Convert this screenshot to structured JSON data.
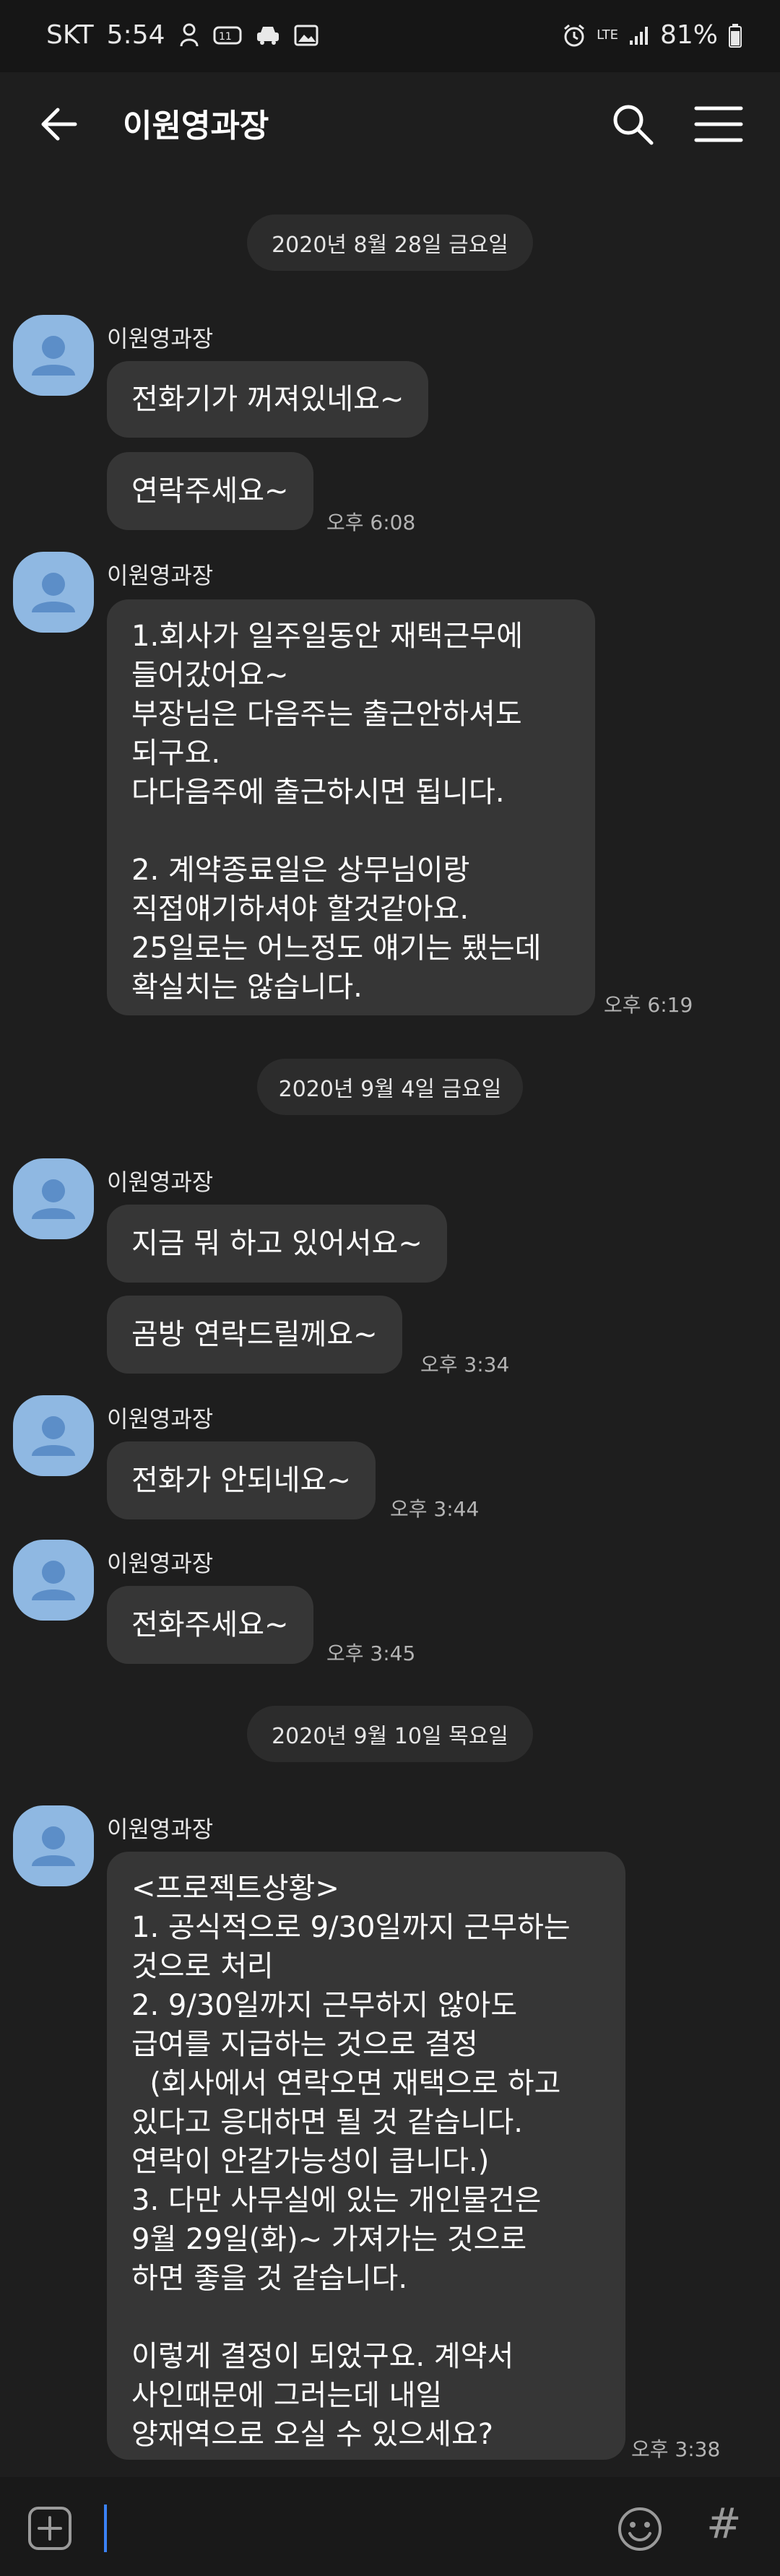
{
  "status_bar": {
    "carrier": "SKT",
    "time": "5:54",
    "signal_label": "LTE",
    "battery": "81%"
  },
  "header": {
    "title": "이원영과장"
  },
  "messages": {
    "date1": "2020년 8월 28일 금요일",
    "sender": "이원영과장",
    "m1": "전화기가 꺼져있네요~",
    "m2": "연락주세요~",
    "t2": "오후 6:08",
    "m3": [
      "1.회사가 일주일동안 재택근무에",
      "들어갔어요~",
      "부장님은 다음주는 출근안하셔도",
      "되구요.",
      "다다음주에 출근하시면 됩니다.",
      "",
      "2. 계약종료일은 상무님이랑",
      "직접얘기하셔야 할것같아요.",
      "25일로는 어느정도 얘기는 됐는데",
      "확실치는 않습니다."
    ],
    "t3": "오후 6:19",
    "date2": "2020년 9월 4일 금요일",
    "m4": "지금 뭐 하고 있어서요~",
    "m5": "곰방 연락드릴께요~",
    "t5": "오후 3:34",
    "m6": "전화가 안되네요~",
    "t6": "오후 3:44",
    "m7": "전화주세요~",
    "t7": "오후 3:45",
    "date3": "2020년 9월 10일 목요일",
    "m8": [
      "<프로젝트상황>",
      "1. 공식적으로 9/30일까지 근무하는",
      "것으로 처리",
      "2. 9/30일까지 근무하지 않아도",
      "급여를 지급하는 것으로 결정",
      "  (회사에서 연락오면 재택으로 하고",
      "있다고 응대하면 될 것 같습니다.",
      "연락이 안갈가능성이 큽니다.)",
      "3. 다만 사무실에 있는 개인물건은",
      "9월 29일(화)~ 가져가는 것으로",
      "하면 좋을 것 같습니다.",
      "",
      "이렇게 결정이 되었구요. 계약서",
      "사인때문에 그러는데 내일",
      "양재역으로 오실 수 있으세요?"
    ],
    "t8": "오후 3:38"
  },
  "colors": {
    "background": "#1e1e1e",
    "bubble": "#363636",
    "avatar": "#8fb8e2",
    "cursor": "#3b82f6"
  },
  "icons": [
    "back-arrow-icon",
    "search-icon",
    "menu-icon",
    "person-icon",
    "add-icon",
    "emoji-icon",
    "hash-icon"
  ]
}
